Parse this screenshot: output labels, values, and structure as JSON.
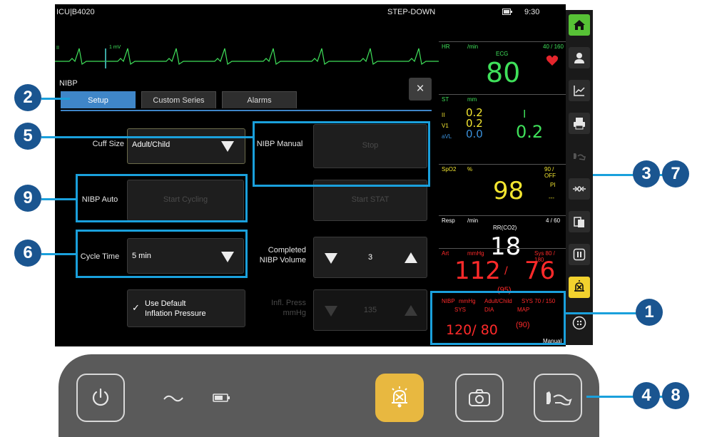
{
  "status_bar": {
    "location": "ICU|B4020",
    "care_area": "STEP-DOWN",
    "time": "9:30"
  },
  "waveform": {
    "ecg_scale": "1 mV",
    "lead": "II"
  },
  "nibp_panel": {
    "title": "NIBP",
    "tabs": [
      {
        "label": "Setup",
        "active": true
      },
      {
        "label": "Custom Series",
        "active": false
      },
      {
        "label": "Alarms",
        "active": false
      }
    ],
    "close_label": "×",
    "cuff_size_label": "Cuff Size",
    "cuff_size_value": "Adult/Child",
    "nibp_manual_label": "NIBP Manual",
    "stop_label": "Stop",
    "nibp_auto_label": "NIBP Auto",
    "start_cycling_label": "Start Cycling",
    "start_stat_label": "Start STAT",
    "cycle_time_label": "Cycle Time",
    "cycle_time_value": "5 min",
    "completed_volume_label_1": "Completed",
    "completed_volume_label_2": "NIBP Volume",
    "completed_volume_value": "3",
    "use_default_label_1": "Use Default",
    "use_default_label_2": "Inflation Pressure",
    "use_default_checked": true,
    "infl_press_label_1": "Infl. Press",
    "infl_press_label_2": "mmHg",
    "infl_press_value": "135"
  },
  "parameters": {
    "hr": {
      "label": "HR",
      "unit": "/min",
      "limits": "40 / 160",
      "source": "ECG",
      "value": "80",
      "color": "#3fe05a"
    },
    "st": {
      "label": "ST",
      "unit": "mm",
      "lead_ii": "II",
      "lead_v1": "V1",
      "lead_avl": "aVL",
      "val_ii": "0.2",
      "val_v1": "0.2",
      "val_avl": "0.0",
      "val_right_lead": "I",
      "val_right": "0.2"
    },
    "spo2": {
      "label": "SpO2",
      "unit": "%",
      "limits": "90 / OFF",
      "pi_label": "PI",
      "pi_value": "---",
      "value": "98",
      "color": "#f2e530"
    },
    "resp": {
      "label": "Resp",
      "unit": "/min",
      "limits": "4 / 60",
      "source": "RR(CO2)",
      "value": "18",
      "color": "#ffffff"
    },
    "art": {
      "label": "Art",
      "unit": "mmHg",
      "limits": "Sys 80 / 180",
      "sys": "112",
      "sep": "/",
      "dia": "76",
      "map": "(95)",
      "color": "#ff2a2a"
    },
    "nibp": {
      "label": "NIBP",
      "unit": "mmHg",
      "cuff": "Adult/Child",
      "limits": "SYS 70 / 150",
      "sys_label": "SYS",
      "dia_label": "DIA",
      "map_label": "MAP",
      "value": "120/ 80",
      "map": "(90)",
      "mode": "Manual",
      "color": "#ff2a2a"
    }
  },
  "side_rail": [
    "home-icon",
    "patient-icon",
    "trends-icon",
    "print-icon",
    "nibp-cuff-icon",
    "zero-icon",
    "clipboard-icon",
    "pause-icon",
    "alarm-silence-icon",
    "menu-icon"
  ],
  "hardware_buttons": [
    "power-icon",
    "ac-power-icon",
    "battery-icon",
    "alarm-silence-icon",
    "camera-icon",
    "nibp-start-icon"
  ],
  "callouts": [
    "1",
    "2",
    "3",
    "4",
    "5",
    "6",
    "7",
    "8",
    "9"
  ],
  "colors": {
    "accent_blue": "#3f86c8",
    "callout_blue": "#1aa0dc",
    "badge_blue": "#1a5590",
    "home_green": "#57c236",
    "alarm_yellow": "#f2d22e"
  }
}
